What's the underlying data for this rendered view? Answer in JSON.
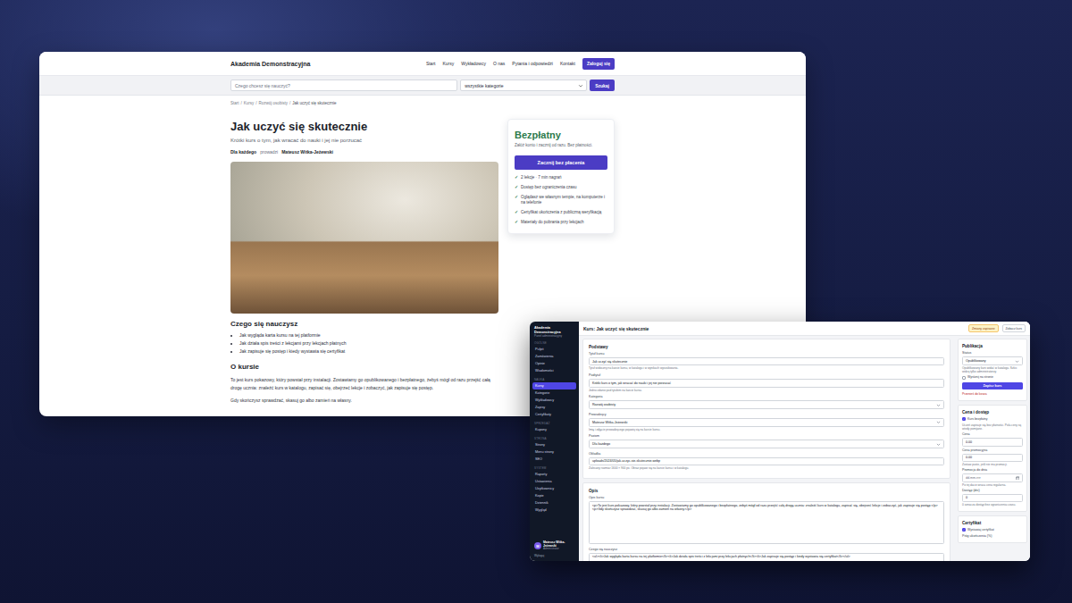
{
  "front": {
    "brand": "Akademia Demonstracyjna",
    "nav": [
      "Start",
      "Kursy",
      "Wykładowcy",
      "O nas",
      "Pytania i odpowiedzi",
      "Kontakt"
    ],
    "login": "Zaloguj się",
    "search": {
      "placeholder": "Czego chcesz się nauczyć?",
      "category": "wszystkie kategorie",
      "button": "Szukaj"
    },
    "breadcrumb": [
      "Start",
      "Kursy",
      "Rozwój osobisty",
      "Jak uczyć się skutecznie"
    ],
    "breadcrumb_separator": "/",
    "title": "Jak uczyć się skutecznie",
    "subtitle": "Krótki kurs o tym, jak wracać do nauki i jej nie porzucać",
    "meta": {
      "level": "Dla każdego",
      "by": "prowadzi",
      "teacher": "Mateusz Witka-Jeżewski"
    },
    "learn": {
      "heading": "Czego się nauczysz",
      "items": [
        "Jak wygląda karta kursu na tej platformie",
        "Jak działa spis treści z lekcjami przy lekcjach płatnych",
        "Jak zapisuje się postęp i kiedy wystawia się certyfikat"
      ]
    },
    "about": {
      "heading": "O kursie",
      "paragraphs": [
        "To jest kurs pokazowy, który powstał przy instalacji. Zostawiamy go opublikowanego i bezpłatnego, żebyś mógł od razu przejść całą drogę ucznia: znaleźć kurs w katalogu, zapisać się, obejrzeć lekcje i zobaczyć, jak zapisuje się postęp.",
        "Gdy skończysz sprawdzać, skasuj go albo zamień na własny."
      ]
    },
    "price_card": {
      "price": "Bezpłatny",
      "note": "Załóż konto i zacznij od razu. Bez płatności.",
      "button": "Zacznij bez płacenia",
      "check_mark": "✓",
      "features": [
        "2 lekcje · 7 min nagrań",
        "Dostęp bez ograniczenia czasu",
        "Oglądasz we własnym tempie, na komputerze i na telefonie",
        "Certyfikat ukończenia z publiczną weryfikacją",
        "Materiały do pobrania przy lekcjach"
      ]
    }
  },
  "admin": {
    "sidebar": {
      "brand": "Akademia Demonstracyjna",
      "tagline": "Panel administracyjny",
      "sections": [
        {
          "label": "OGÓLNE",
          "items": [
            {
              "label": "Pulpit",
              "selected": false
            },
            {
              "label": "Zamówienia",
              "selected": false
            },
            {
              "label": "Opinie",
              "selected": false
            },
            {
              "label": "Wiadomości",
              "selected": false
            }
          ]
        },
        {
          "label": "NAUKA",
          "items": [
            {
              "label": "Kursy",
              "selected": true
            },
            {
              "label": "Kategorie",
              "selected": false
            },
            {
              "label": "Wykładowcy",
              "selected": false
            },
            {
              "label": "Zapisy",
              "selected": false
            },
            {
              "label": "Certyfikaty",
              "selected": false
            }
          ]
        },
        {
          "label": "SPRZEDAŻ",
          "items": [
            {
              "label": "Kupony",
              "selected": false
            }
          ]
        },
        {
          "label": "STRONA",
          "items": [
            {
              "label": "Strony",
              "selected": false
            },
            {
              "label": "Menu strony",
              "selected": false
            },
            {
              "label": "SEO",
              "selected": false
            }
          ]
        },
        {
          "label": "SYSTEM",
          "items": [
            {
              "label": "Raporty",
              "selected": false
            },
            {
              "label": "Ustawienia",
              "selected": false
            },
            {
              "label": "Użytkownicy",
              "selected": false
            },
            {
              "label": "Kopie",
              "selected": false
            },
            {
              "label": "Dziennik",
              "selected": false
            },
            {
              "label": "Wygląd",
              "selected": false
            }
          ]
        }
      ],
      "user": {
        "initial": "M",
        "name": "Mateusz Witka-Jeżewski",
        "role": "Administrator"
      },
      "logout": "Wyloguj"
    },
    "topbar": {
      "title": "Kurs: Jak uczyć się skutecznie",
      "badge": "Zmiany zapisane",
      "link": "Zobacz kurs"
    },
    "basics": {
      "heading": "Podstawy",
      "fields": [
        {
          "label": "Tytuł kursu",
          "value": "Jak uczyć się skutecznie",
          "kind": "text",
          "hint": "Tytuł widoczny na karcie kursu, w katalogu i w wynikach wyszukiwania."
        },
        {
          "label": "Podtytuł",
          "value": "Krótki kurs o tym, jak wracać do nauki i jej nie porzucać",
          "kind": "text",
          "hint": "Jedno zdanie pod tytułem na karcie kursu."
        },
        {
          "label": "Kategoria",
          "value": "Rozwój osobisty",
          "kind": "select"
        },
        {
          "label": "Prowadzący",
          "value": "Mateusz Witka-Jeżewski",
          "kind": "select",
          "hint": "Imię i zdjęcie prowadzącego pojawią się na karcie kursu."
        },
        {
          "label": "Poziom",
          "value": "Dla każdego",
          "kind": "select"
        },
        {
          "label": "Okładka",
          "value": "uploads/2024/05/jak-uczyc-sie-skutecznie.webp",
          "kind": "text",
          "hint": "Zalecany rozmiar 1600 × 900 px. Obraz pojawi się na karcie kursu i w katalogu."
        }
      ]
    },
    "description": {
      "heading": "Opis",
      "fields": [
        {
          "label": "Opis kursu",
          "value": "<p>To jest kurs pokazowy, który powstał przy instalacji. Zostawiamy go opublikowanego i bezpłatnego, żebyś mógł od razu przejść całą drogę ucznia: znaleźć kurs w katalogu, zapisać się, obejrzeć lekcje i zobaczyć, jak zapisuje się postęp.</p><p>Gdy skończysz sprawdzać, skasuj go albo zamień na własny.</p>",
          "kind": "textarea"
        },
        {
          "label": "Czego się nauczysz",
          "value": "<ul><li>Jak wygląda karta kursu na tej platformie</li><li>Jak działa spis treści z lekcjami przy lekcjach płatnych</li><li>Jak zapisuje się postęp i kiedy wystawia się certyfikat</li></ul>",
          "kind": "textarea"
        }
      ]
    },
    "publish": {
      "heading": "Publikacja",
      "status": {
        "label": "Status",
        "value": "Opublikowany",
        "hint": "Opublikowany kurs widać w katalogu. Szkic widzą tylko administratorzy."
      },
      "featured": {
        "label": "Wyróżnij na stronie",
        "checked": false
      },
      "save": "Zapisz kurs",
      "trash": "Przenieś do kosza"
    },
    "pricing": {
      "heading": "Cena i dostęp",
      "free": {
        "label": "Kurs bezpłatny",
        "checked": true,
        "hint": "Uczeń zapisuje się bez płatności. Pola ceny są wtedy pomijane."
      },
      "fields": [
        {
          "label": "Cena",
          "value": "0.00",
          "kind": "text"
        },
        {
          "label": "Cena promocyjna",
          "value": "0.00",
          "kind": "text",
          "hint": "Zostaw puste, jeśli nie ma promocji."
        },
        {
          "label": "Promocja do dnia",
          "value": "dd.mm.rrrr",
          "kind": "date",
          "hint": "Po tej dacie wraca cena regularna."
        },
        {
          "label": "Dostęp (dni)",
          "value": "0",
          "kind": "text",
          "hint": "0 oznacza dostęp bez ograniczenia czasu."
        }
      ]
    },
    "certificate": {
      "heading": "Certyfikat",
      "issue": {
        "label": "Wystawiaj certyfikat",
        "checked": true
      },
      "threshold_label": "Próg ukończenia (%)"
    }
  }
}
